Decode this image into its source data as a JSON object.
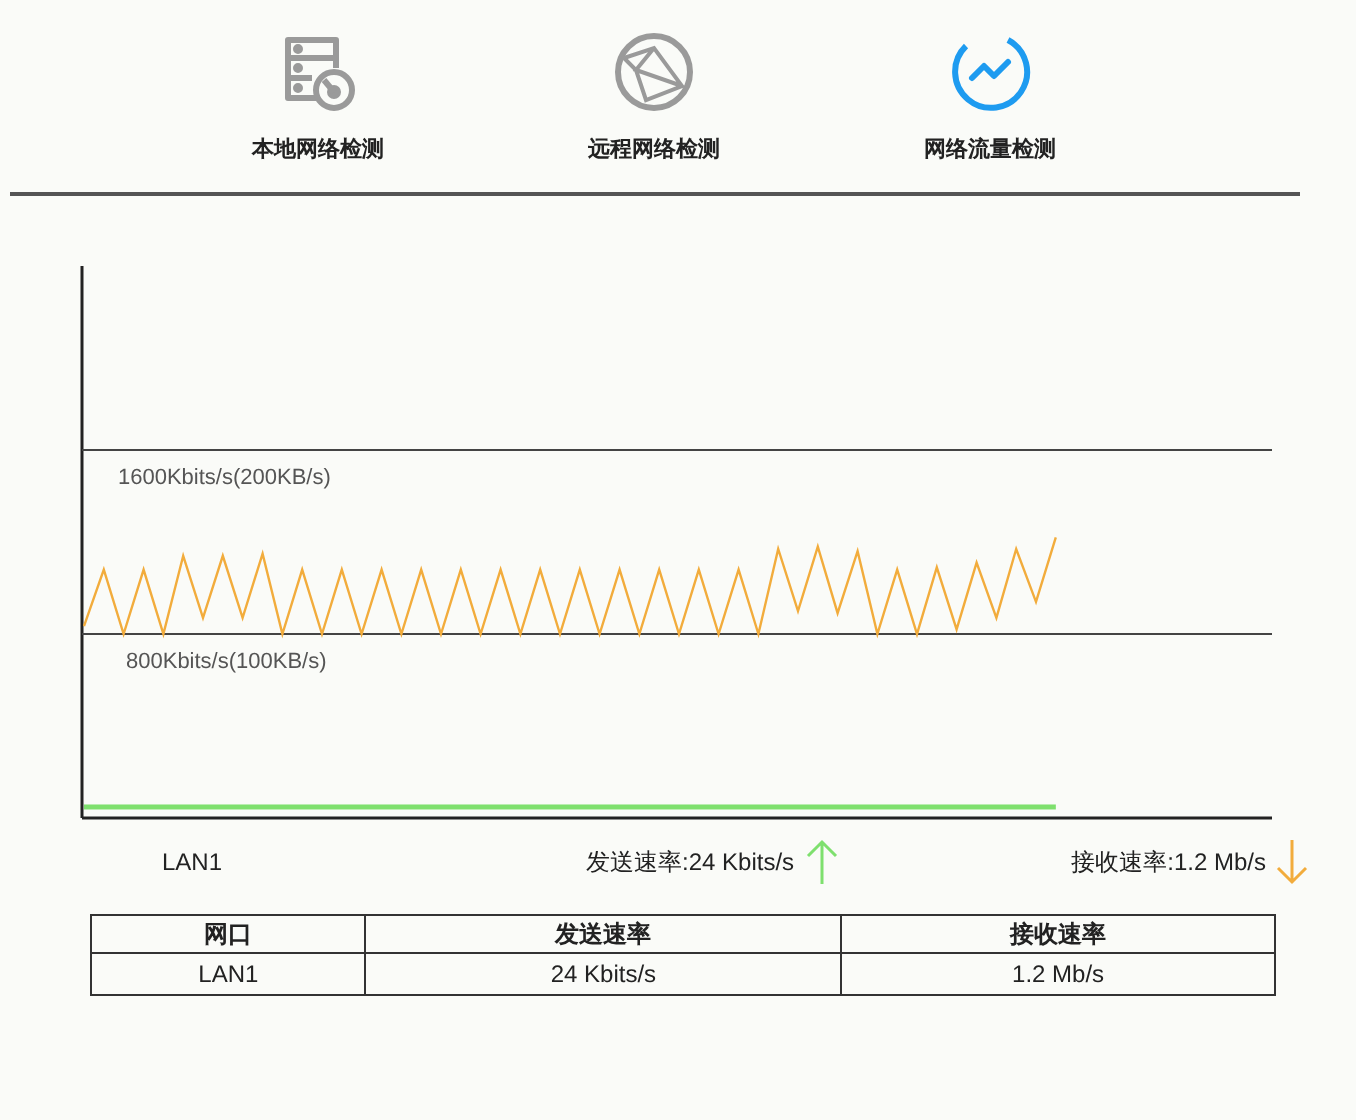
{
  "tabs": [
    {
      "label": "本地网络检测",
      "selected": false
    },
    {
      "label": "远程网络检测",
      "selected": false
    },
    {
      "label": "网络流量检测",
      "selected": true
    }
  ],
  "chart": {
    "grid_labels": [
      "1600Kbits/s(200KB/s)",
      "800Kbits/s(100KB/s)"
    ],
    "lines": [
      {
        "color": "#f2ac3c"
      },
      {
        "color": "#7ee06e"
      }
    ],
    "legend": {
      "interface": "LAN1",
      "send": "发送速率:24 Kbits/s",
      "receive": "接收速率:1.2 Mb/s"
    }
  },
  "table": {
    "columns": [
      "网口",
      "发送速率",
      "接收速率"
    ],
    "rows": [
      [
        "LAN1",
        "24 Kbits/s",
        "1.2 Mb/s"
      ]
    ]
  }
}
